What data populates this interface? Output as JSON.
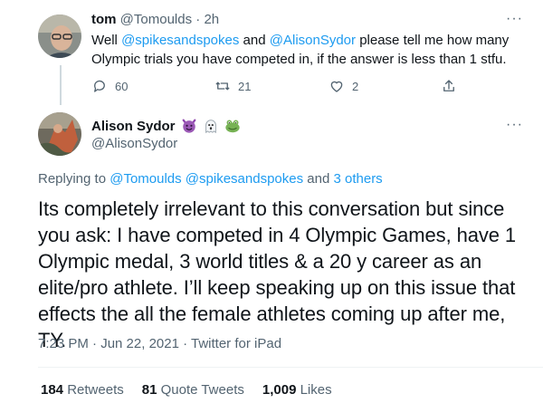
{
  "parent_tweet": {
    "name": "tom",
    "handle": "@Tomoulds",
    "dot": "·",
    "time": "2h",
    "text": {
      "p1": "Well ",
      "m1": "@spikesandspokes",
      "p2": " and ",
      "m2": "@AlisonSydor",
      "p3": " please tell me how many Olympic trials you have competed in, if the answer is less than 1 stfu."
    },
    "replies": "60",
    "retweets": "21",
    "likes": "2"
  },
  "main_tweet": {
    "name": "Alison Sydor",
    "handle": "@AlisonSydor",
    "replying_prefix": "Replying to ",
    "replying_users": "@Tomoulds @spikesandspokes",
    "replying_and": " and ",
    "replying_others": "3 others",
    "text": "Its completely irrelevant to this conversation but since you ask: I have competed in 4 Olympic Games, have 1 Olympic medal, 3 world titles & a 20 y career as an elite/pro athlete. I’ll keep speaking up on this issue that effects the all the female athletes coming up after me, TY.",
    "timestamp": "7:23 PM · Jun 22, 2021 · ",
    "source": "Twitter for iPad",
    "stats": {
      "retweets_count": "184",
      "retweets_label": "Retweets",
      "quotes_count": "81",
      "quotes_label": "Quote Tweets",
      "likes_count": "1,009",
      "likes_label": "Likes"
    }
  },
  "more_symbol": "···",
  "colors": {
    "link": "#1d9bf0",
    "muted": "#536471",
    "text": "#0f1419"
  }
}
